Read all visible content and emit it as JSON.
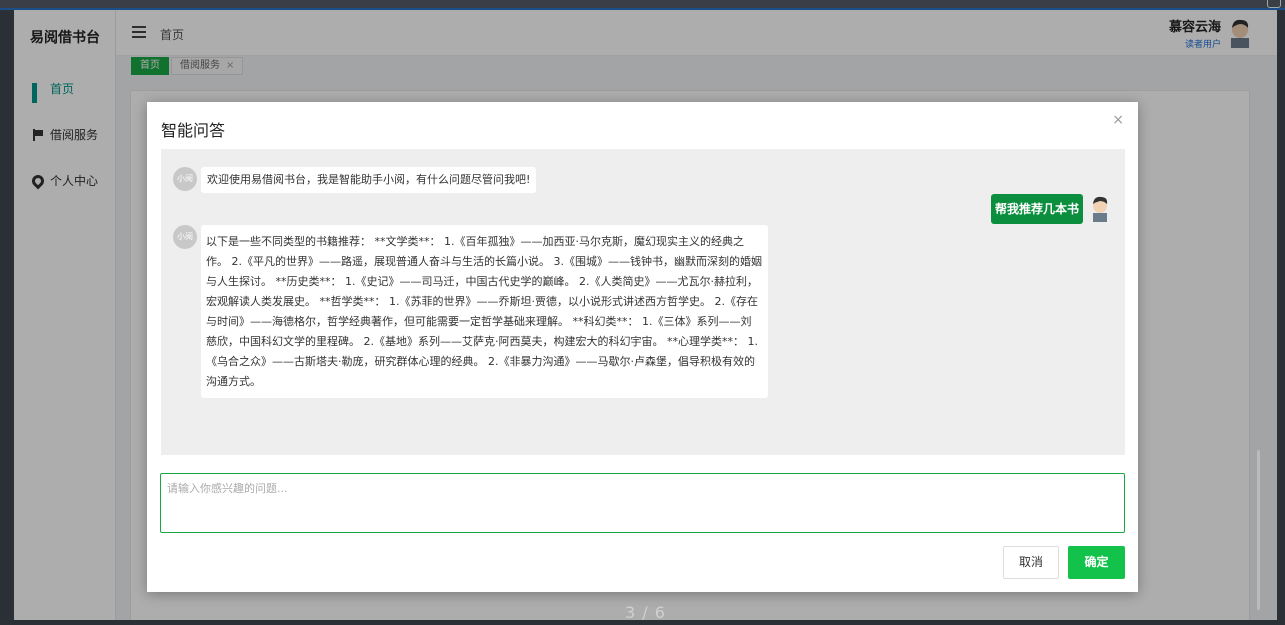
{
  "app": {
    "brand": "易阅借书台"
  },
  "sidebar": {
    "items": [
      {
        "label": "首页",
        "icon": "grid-icon"
      },
      {
        "label": "借阅服务",
        "icon": "flag-icon"
      },
      {
        "label": "个人中心",
        "icon": "location-pin-icon"
      }
    ]
  },
  "header": {
    "breadcrumb": "首页",
    "user_name": "慕容云海",
    "user_role": "读者用户"
  },
  "tabs": [
    {
      "label": "首页"
    },
    {
      "label": "借阅服务"
    }
  ],
  "dialog": {
    "title": "智能问答",
    "close": "×",
    "bot_avatar_label": "小阅",
    "messages": {
      "welcome": "欢迎使用易借阅书台，我是智能助手小阅，有什么问题尽管问我吧!",
      "user_question": "帮我推荐几本书",
      "bot_reply": "以下是一些不同类型的书籍推荐：  **文学类**：  1.《百年孤独》——加西亚·马尔克斯，魔幻现实主义的经典之作。 2.《平凡的世界》——路遥，展现普通人奋斗与生活的长篇小说。 3.《围城》——钱钟书，幽默而深刻的婚姻与人生探讨。 **历史类**：  1.《史记》——司马迁，中国古代史学的巅峰。 2.《人类简史》——尤瓦尔·赫拉利，宏观解读人类发展史。 **哲学类**：  1.《苏菲的世界》——乔斯坦·贾德，以小说形式讲述西方哲学史。 2.《存在与时间》——海德格尔，哲学经典著作，但可能需要一定哲学基础来理解。 **科幻类**：  1.《三体》系列——刘慈欣，中国科幻文学的里程碑。 2.《基地》系列——艾萨克·阿西莫夫，构建宏大的科幻宇宙。 **心理学类**：  1.《乌合之众》——古斯塔夫·勒庞，研究群体心理的经典。 2.《非暴力沟通》——马歇尔·卢森堡，倡导积极有效的沟通方式。"
    },
    "input_placeholder": "请输入你感兴趣的问题...",
    "cancel_label": "取消",
    "ok_label": "确定"
  },
  "pager": "3 / 6",
  "colors": {
    "accent": "#009688",
    "primary_green": "#12c24a",
    "user_bubble": "#0b8f3e"
  }
}
